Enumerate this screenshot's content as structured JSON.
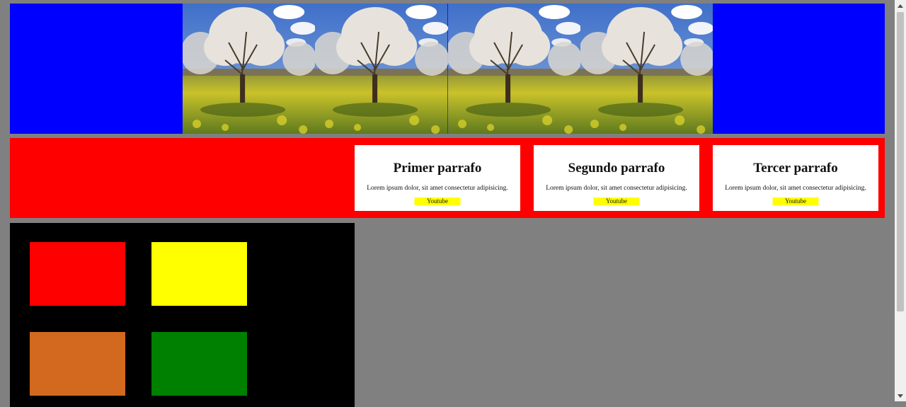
{
  "header": {
    "background_color": "#0000ff",
    "gallery_image": "blossoming-tree-orchard-photo",
    "gallery_count": 4
  },
  "band": {
    "background_color": "#ff0000",
    "cards": [
      {
        "title": "Primer parrafo",
        "text": "Lorem ipsum dolor, sit amet consectetur adipisicing.",
        "button": "Youtube"
      },
      {
        "title": "Segundo parrafo",
        "text": "Lorem ipsum dolor, sit amet consectetur adipisicing.",
        "button": "Youtube"
      },
      {
        "title": "Tercer parrafo",
        "text": "Lorem ipsum dolor, sit amet consectetur adipisicing.",
        "button": "Youtube"
      }
    ]
  },
  "grid": {
    "background_color": "#000000",
    "squares": [
      "#ff0000",
      "#ffff00",
      "#d2691e",
      "#008000"
    ]
  },
  "scrollbar": {
    "up_icon": "scroll-up-arrow-icon",
    "down_icon": "scroll-down-arrow-icon"
  }
}
